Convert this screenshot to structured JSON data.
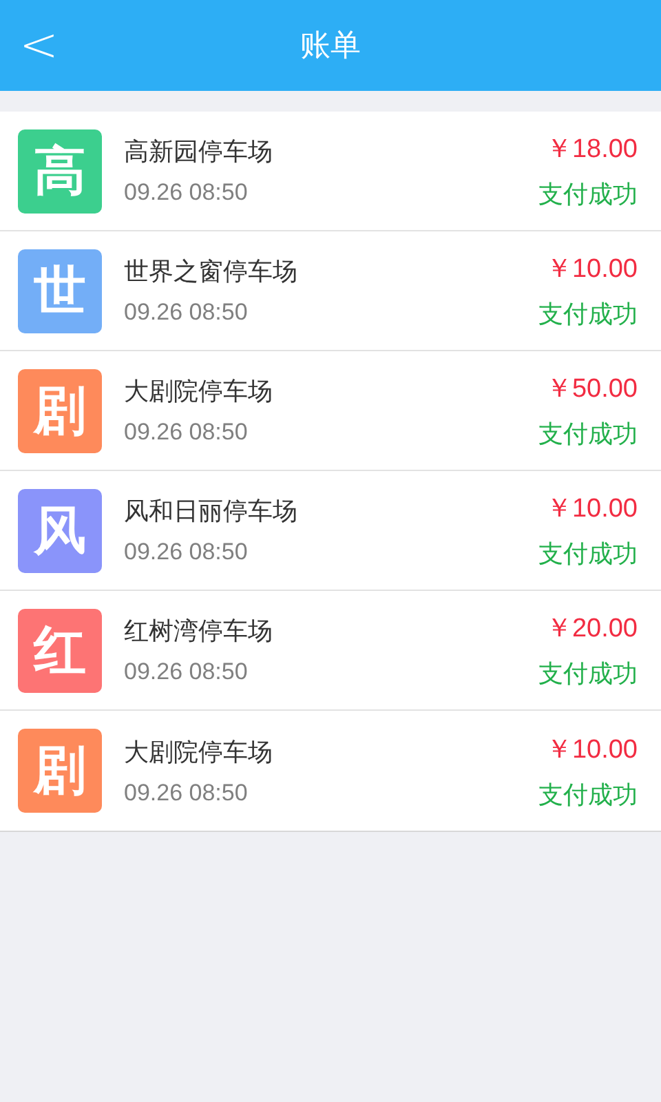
{
  "header": {
    "back": "<",
    "title": "账单"
  },
  "bills": [
    {
      "badge": "高",
      "color": "#3ccf8e",
      "name": "高新园停车场",
      "time": "09.26 08:50",
      "amount": "￥18.00",
      "status": "支付成功"
    },
    {
      "badge": "世",
      "color": "#73aef7",
      "name": "世界之窗停车场",
      "time": "09.26 08:50",
      "amount": "￥10.00",
      "status": "支付成功"
    },
    {
      "badge": "剧",
      "color": "#fe8a5b",
      "name": "大剧院停车场",
      "time": "09.26 08:50",
      "amount": "￥50.00",
      "status": "支付成功"
    },
    {
      "badge": "风",
      "color": "#8a94fa",
      "name": "风和日丽停车场",
      "time": "09.26 08:50",
      "amount": "￥10.00",
      "status": "支付成功"
    },
    {
      "badge": "红",
      "color": "#fd7474",
      "name": "红树湾停车场",
      "time": "09.26 08:50",
      "amount": "￥20.00",
      "status": "支付成功"
    },
    {
      "badge": "剧",
      "color": "#fe8a5b",
      "name": "大剧院停车场",
      "time": "09.26 08:50",
      "amount": "￥10.00",
      "status": "支付成功"
    }
  ]
}
